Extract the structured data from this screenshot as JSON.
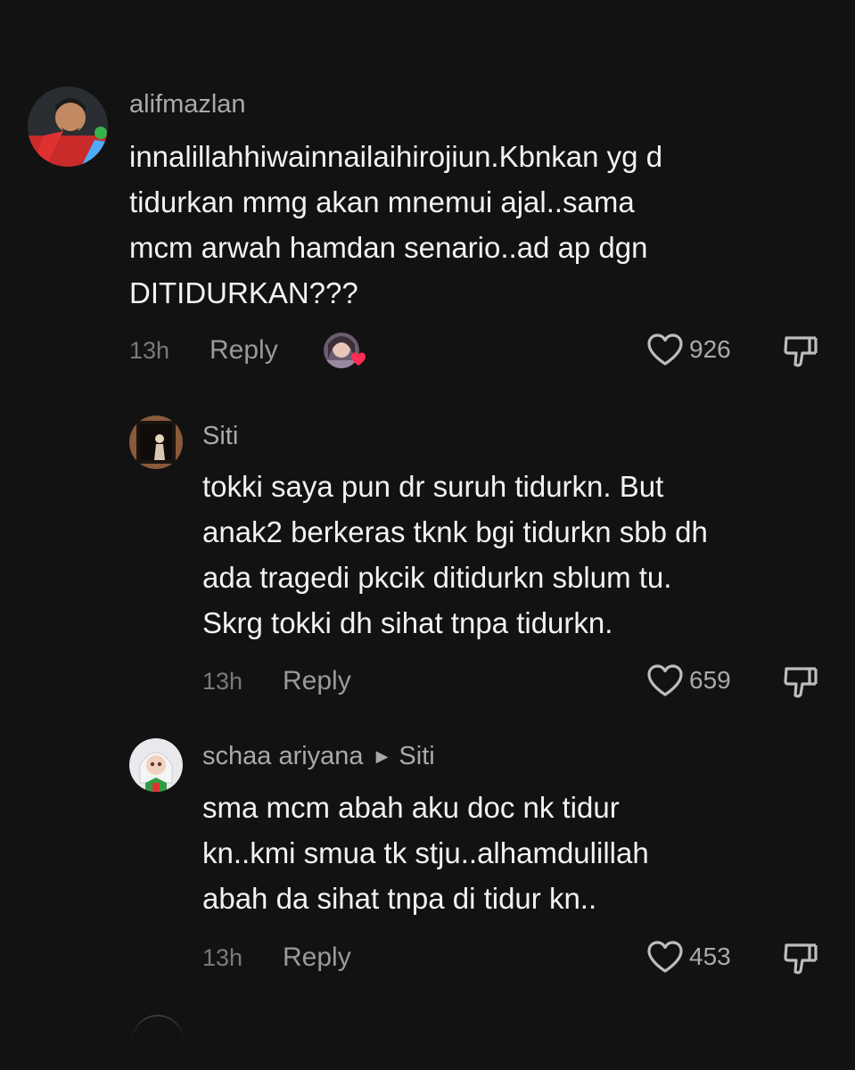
{
  "comments": [
    {
      "username": "alifmazlan",
      "lines": [
        "innalillahhiwainnailaihirojiun.Kbnkan yg d",
        "tidurkan mmg akan mnemui ajal..sama",
        "mcm arwah hamdan senario..ad ap dgn",
        "DITIDURKAN???"
      ],
      "time": "13h",
      "reply_label": "Reply",
      "likes": "926"
    },
    {
      "username": "Siti",
      "lines": [
        "tokki saya pun dr suruh tidurkn. But",
        "anak2 berkeras tknk bgi tidurkn sbb dh",
        "ada tragedi pkcik ditidurkn sblum tu.",
        "Skrg tokki dh sihat tnpa tidurkn."
      ],
      "time": "13h",
      "reply_label": "Reply",
      "likes": "659"
    },
    {
      "username": "schaa ariyana",
      "reply_to": "Siti",
      "lines": [
        "sma mcm abah aku doc nk tidur",
        "kn..kmi smua tk stju..alhamdulillah",
        "abah da sihat tnpa di tidur kn.."
      ],
      "time": "13h",
      "reply_label": "Reply",
      "likes": "453"
    }
  ],
  "icons": {
    "like": "heart-outline-icon",
    "dislike": "thumbs-down-icon",
    "reply_to": "triangle-right-icon",
    "creator_like": "creator-liked-heart-icon"
  },
  "colors": {
    "background": "#121212",
    "creator_heart": "#fe2c55"
  }
}
